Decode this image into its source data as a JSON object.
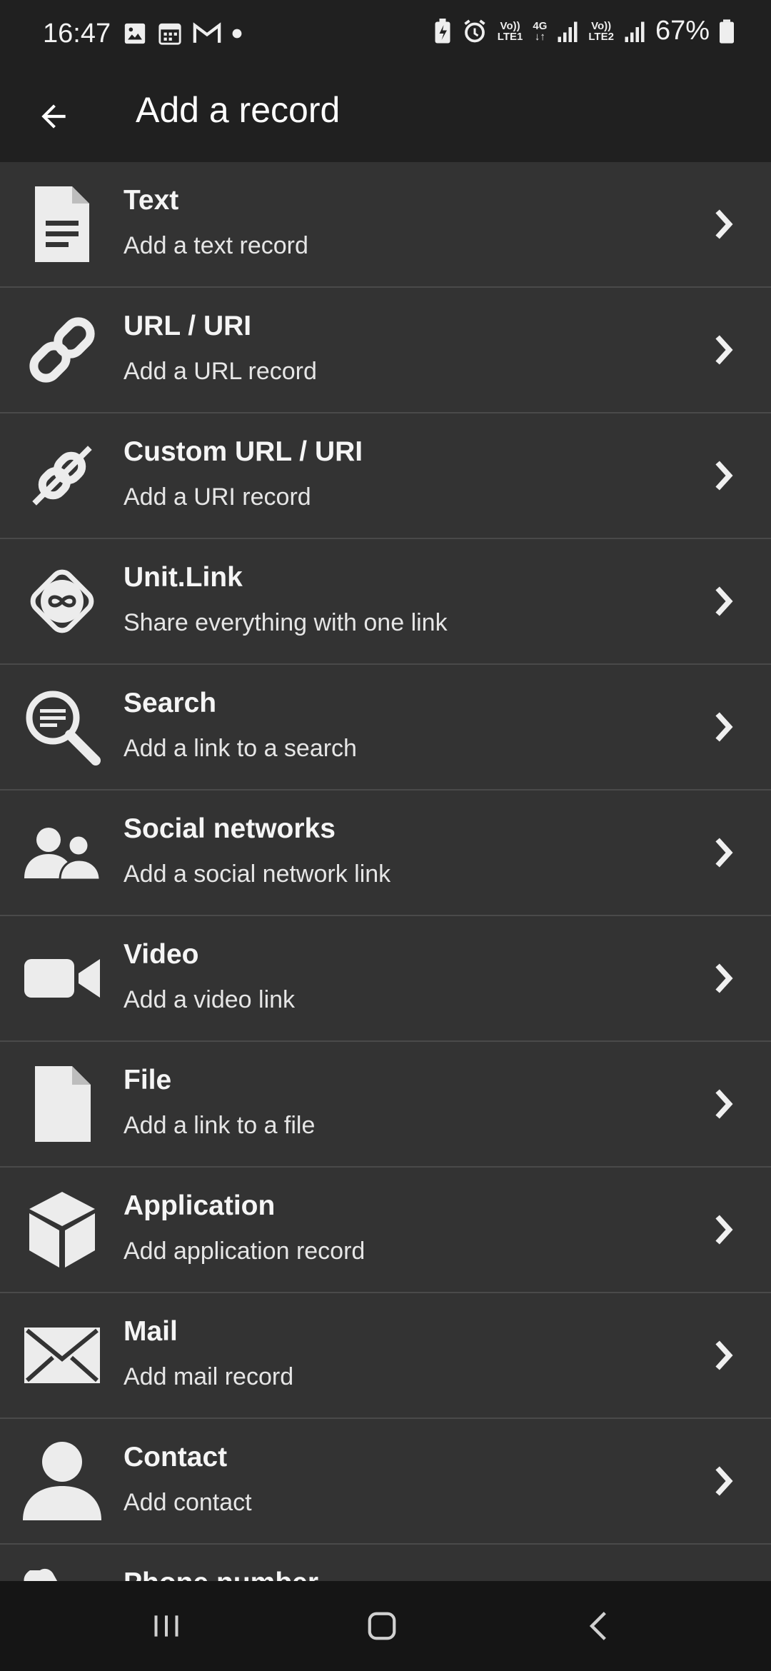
{
  "status": {
    "time": "16:47",
    "battery": "67%",
    "net1_top": "Vo))",
    "net1_bottom": "LTE1",
    "net_4g": "4G",
    "net2_top": "Vo))",
    "net2_bottom": "LTE2"
  },
  "header": {
    "title": "Add a record"
  },
  "records": [
    {
      "title": "Text",
      "subtitle": "Add a text record",
      "icon": "text-document-icon"
    },
    {
      "title": "URL / URI",
      "subtitle": "Add a URL record",
      "icon": "link-icon"
    },
    {
      "title": "Custom URL / URI",
      "subtitle": "Add a URI record",
      "icon": "custom-link-icon"
    },
    {
      "title": "Unit.Link",
      "subtitle": "Share everything with one link",
      "icon": "unit-link-icon"
    },
    {
      "title": "Search",
      "subtitle": "Add a link to a search",
      "icon": "search-icon"
    },
    {
      "title": "Social networks",
      "subtitle": "Add a social network link",
      "icon": "people-icon"
    },
    {
      "title": "Video",
      "subtitle": "Add a video link",
      "icon": "video-camera-icon"
    },
    {
      "title": "File",
      "subtitle": "Add a link to a file",
      "icon": "file-icon"
    },
    {
      "title": "Application",
      "subtitle": "Add application record",
      "icon": "cube-icon"
    },
    {
      "title": "Mail",
      "subtitle": "Add mail record",
      "icon": "envelope-icon"
    },
    {
      "title": "Contact",
      "subtitle": "Add contact",
      "icon": "person-icon"
    },
    {
      "title": "Phone number",
      "subtitle": "",
      "icon": "phone-icon"
    }
  ]
}
